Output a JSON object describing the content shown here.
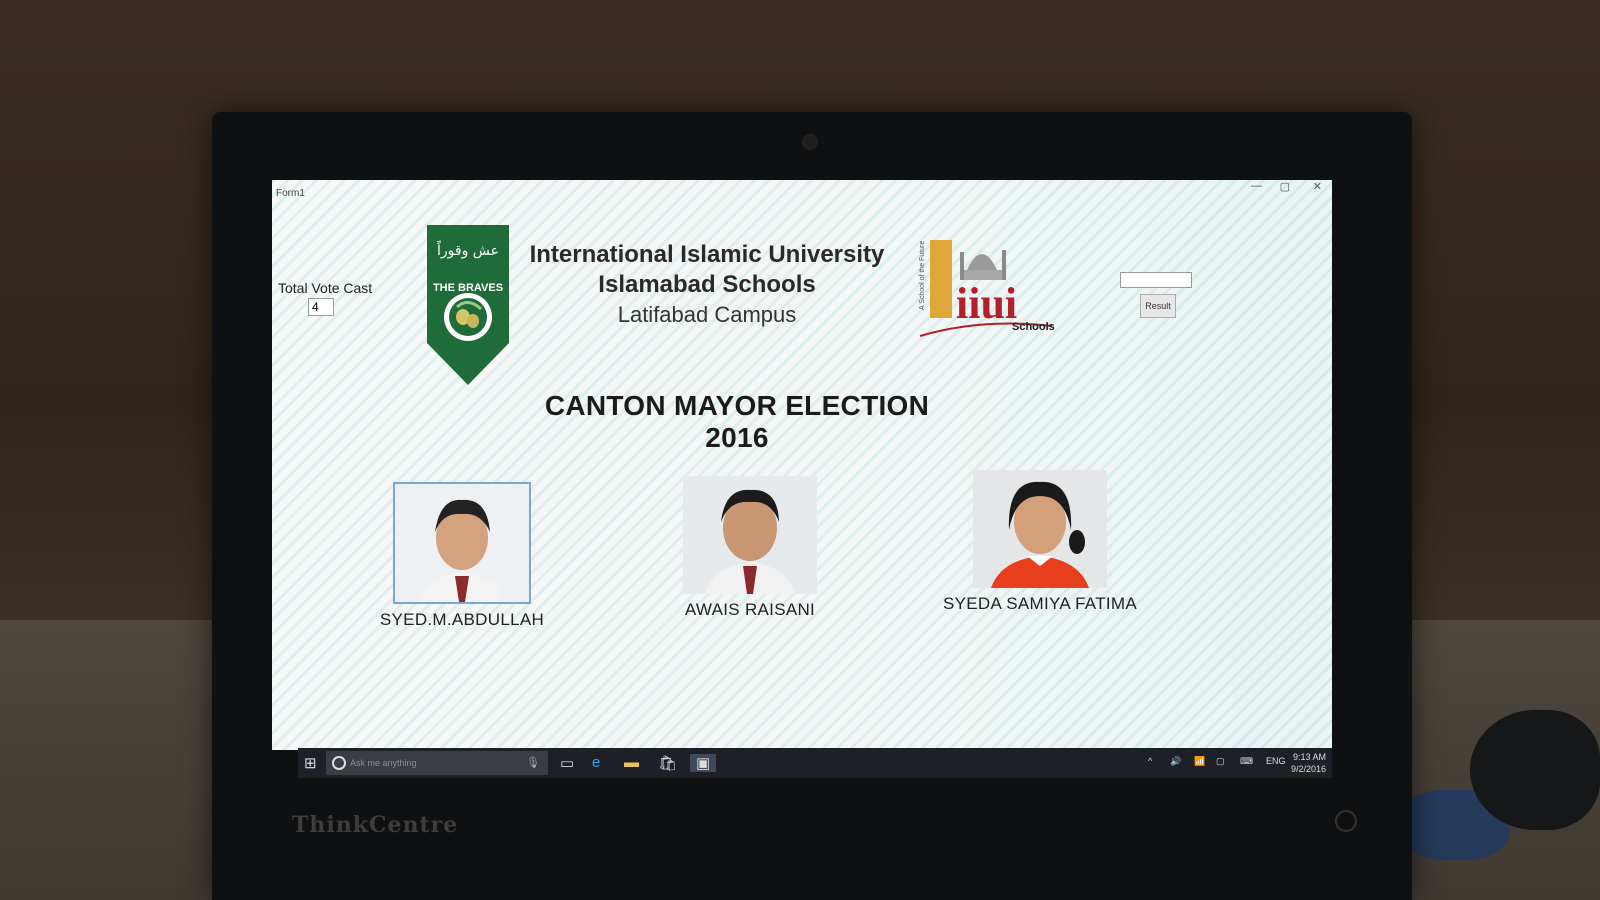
{
  "window": {
    "title": "Form1",
    "minimize": "—",
    "maximize": "▢",
    "close": "✕"
  },
  "stats": {
    "total_vote_label": "Total Vote Cast",
    "total_vote_value": "4"
  },
  "controls": {
    "result_button": "Result",
    "result_value": ""
  },
  "header": {
    "banner_arabic": "عش وقوراً",
    "banner_text": "THE BRAVES",
    "university_line1": "International Islamic University",
    "university_line2": "Islamabad Schools",
    "campus": "Latifabad Campus",
    "logo_text": "iiui",
    "logo_tagline": "A School of the Future",
    "logo_sub": "Schools"
  },
  "election_title": "CANTON MAYOR ELECTION 2016",
  "candidates": [
    {
      "name": "SYED.M.ABDULLAH"
    },
    {
      "name": "AWAIS RAISANI"
    },
    {
      "name": "SYEDA SAMIYA FATIMA"
    }
  ],
  "taskbar": {
    "search_placeholder": "Ask me anything",
    "tray_language": "ENG",
    "time": "9:13 AM",
    "date": "9/2/2016"
  },
  "hardware": {
    "monitor_brand": "ThinkCentre"
  },
  "colors": {
    "banner_green": "#1f6b3a",
    "logo_red": "#b3202a",
    "logo_gold": "#e0a63a"
  }
}
